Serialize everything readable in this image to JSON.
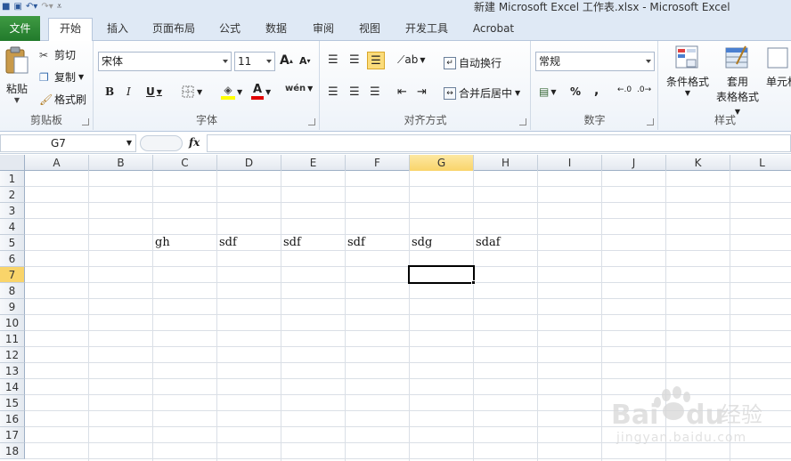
{
  "window": {
    "title": "新建 Microsoft Excel 工作表.xlsx  -  Microsoft Excel",
    "qat": [
      "excel-icon",
      "save-icon",
      "undo-icon",
      "redo-icon",
      "customize-icon"
    ]
  },
  "tabs": {
    "file": "文件",
    "items": [
      "开始",
      "插入",
      "页面布局",
      "公式",
      "数据",
      "审阅",
      "视图",
      "开发工具",
      "Acrobat"
    ],
    "active": "开始"
  },
  "ribbon": {
    "clipboard": {
      "label": "剪贴板",
      "paste": "粘贴",
      "cut": "剪切",
      "copy": "复制",
      "format_painter": "格式刷"
    },
    "font": {
      "label": "字体",
      "family": "宋体",
      "size": "11",
      "bold": "B",
      "italic": "I",
      "underline": "U",
      "grow": "A",
      "shrink": "A"
    },
    "alignment": {
      "label": "对齐方式",
      "wrap": "自动换行",
      "merge": "合并后居中"
    },
    "number": {
      "label": "数字",
      "format": "常规",
      "percent": "%",
      "comma": ","
    },
    "styles": {
      "label": "样式",
      "conditional": "条件格式",
      "table_format_1": "套用",
      "table_format_2": "表格格式",
      "cell_styles": "单元格"
    }
  },
  "formula_bar": {
    "name_box": "G7",
    "fx": "fx",
    "value": ""
  },
  "sheet": {
    "columns": [
      "A",
      "B",
      "C",
      "D",
      "E",
      "F",
      "G",
      "H",
      "I",
      "J",
      "K",
      "L"
    ],
    "rows": [
      "1",
      "2",
      "3",
      "4",
      "5",
      "6",
      "7",
      "8",
      "9",
      "10",
      "11",
      "12",
      "13",
      "14",
      "15",
      "16",
      "17",
      "18"
    ],
    "selected_cell": "G7",
    "cells": [
      {
        "ref": "C5",
        "value": "gh"
      },
      {
        "ref": "D5",
        "value": "sdf"
      },
      {
        "ref": "E5",
        "value": "sdf"
      },
      {
        "ref": "F5",
        "value": "sdf"
      },
      {
        "ref": "G5",
        "value": "sdg"
      },
      {
        "ref": "H5",
        "value": "sdaf"
      }
    ]
  },
  "watermark": {
    "logo": "Bai du 经验",
    "url": "jingyan.baidu.com"
  }
}
